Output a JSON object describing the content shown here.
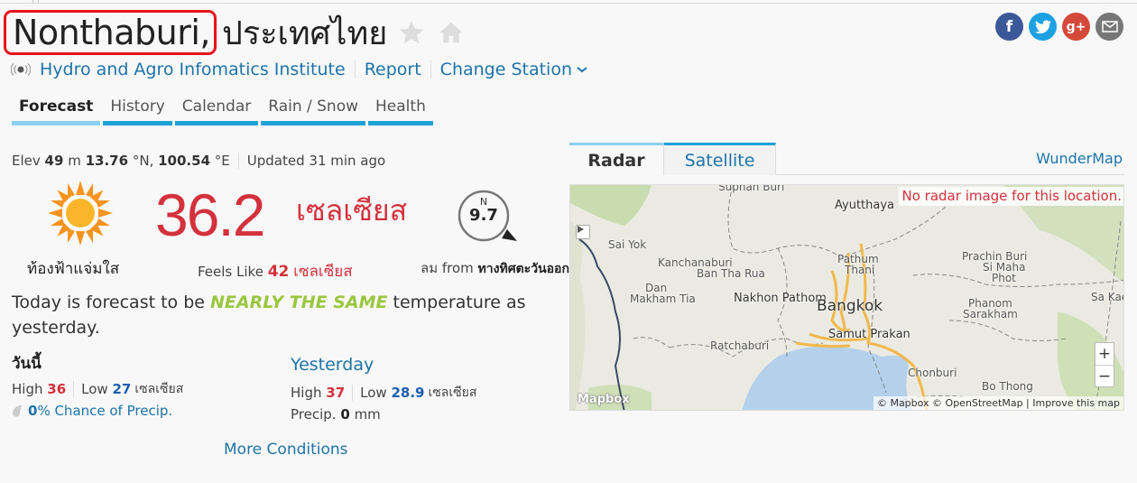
{
  "header": {
    "city": "Nonthaburi,",
    "country": "ประเทศไทย",
    "station_name": "Hydro and Agro Infomatics Institute",
    "report_label": "Report",
    "change_station_label": "Change Station"
  },
  "social": {
    "facebook": "f",
    "twitter": "t",
    "googleplus": "g+",
    "email": "email"
  },
  "tabs": [
    {
      "label": "Forecast",
      "active": true
    },
    {
      "label": "History"
    },
    {
      "label": "Calendar"
    },
    {
      "label": "Rain / Snow"
    },
    {
      "label": "Health"
    }
  ],
  "meta": {
    "elev_label": "Elev",
    "elev_value": "49",
    "elev_unit": "m",
    "lat_value": "13.76",
    "lat_unit": "°N,",
    "lon_value": "100.54",
    "lon_unit": "°E",
    "updated": "Updated 31 min ago"
  },
  "current": {
    "condition": "ท้องฟ้าแจ่มใส",
    "temperature": "36.2",
    "temp_unit": "เซลเซียส",
    "feels_like_label": "Feels Like",
    "feels_like_value": "42",
    "feels_like_unit": "เซลเซียส",
    "wind_north_label": "N",
    "wind_speed": "9.7",
    "wind_from_label": "ลม from",
    "wind_direction": "ทางทิศตะวันออกเฉียงใต้"
  },
  "forecast_summary": {
    "prefix": "Today is forecast to be",
    "highlight": "NEARLY THE SAME",
    "suffix": "temperature as yesterday."
  },
  "today": {
    "title": "วันนี้",
    "high_label": "High",
    "high": "36",
    "low_label": "Low",
    "low": "27",
    "unit": "เซลเซียส",
    "precip_value": "0",
    "precip_text": "% Chance of Precip."
  },
  "yesterday": {
    "title": "Yesterday",
    "high_label": "High",
    "high": "37",
    "low_label": "Low",
    "low": "28.9",
    "unit": "เซลเซียส",
    "precip_label": "Precip.",
    "precip_value": "0",
    "precip_unit": "mm"
  },
  "more_conditions": "More Conditions",
  "map": {
    "tabs": [
      {
        "label": "Radar",
        "active": true
      },
      {
        "label": "Satellite"
      }
    ],
    "wundermap_label": "WunderMap",
    "no_radar": "No radar image for this location.",
    "places": {
      "suphan_buri": "Suphan Buri",
      "ayutthaya": "Ayutthaya",
      "sai_yok": "Sai Yok",
      "kanchanaburi": "Kanchanaburi",
      "ban_tha_rua": "Ban Tha Rua",
      "dan": "Dan",
      "makham_tia": "Makham Tia",
      "nakhon_pathom": "Nakhon Pathom",
      "pathum": "Pathum",
      "thani": "Thani",
      "bangkok": "Bangkok",
      "samut_prakan": "Samut Prakan",
      "ratchaburi": "Ratchaburi",
      "chonburi": "Chonburi",
      "bo_thong": "Bo Thong",
      "prachin_buri": "Prachin Buri",
      "si_maha": "Si Maha",
      "phot": "Phot",
      "phanom": "Phanom",
      "sarakham": "Sarakham",
      "sa_kae": "Sa Kae"
    },
    "zoom_in": "+",
    "zoom_out": "−",
    "logo": "Mapbox",
    "attribution": "© Mapbox © OpenStreetMap | Improve this map"
  }
}
